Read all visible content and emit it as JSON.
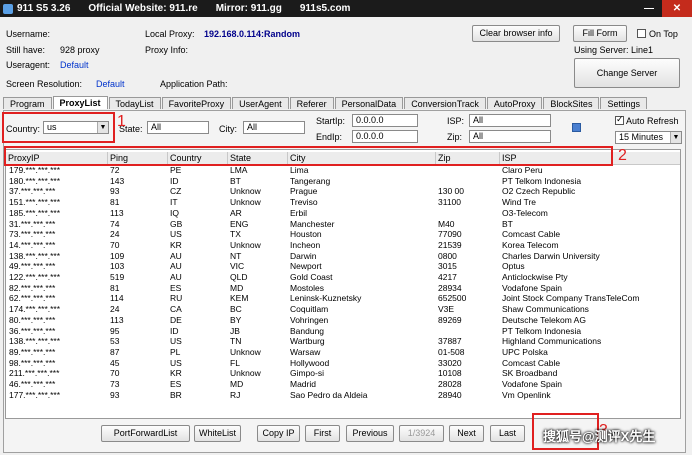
{
  "titlebar": {
    "app": "911 S5 3.26",
    "website": "Official Website: 911.re",
    "mirror": "Mirror: 911.gg",
    "mirror2": "911s5.com"
  },
  "info": {
    "username_label": "Username:",
    "still_have_label": "Still have:",
    "still_have_value": "928  proxy",
    "useragent_label": "Useragent:",
    "useragent_value": "Default",
    "screen_res_label": "Screen Resolution:",
    "screen_res_value": "Default",
    "local_proxy_label": "Local Proxy:",
    "local_proxy_value": "192.168.0.114:Random",
    "proxy_info_label": "Proxy Info:",
    "app_path_label": "Application Path:",
    "clear_browser_label": "Clear browser info",
    "fill_form_label": "Fill Form",
    "on_top_label": "On Top",
    "using_server": "Using Server: Line1",
    "change_server_label": "Change Server"
  },
  "tabs": [
    "Program",
    "ProxyList",
    "TodayList",
    "FavoriteProxy",
    "UserAgent",
    "Referer",
    "PersonalData",
    "ConversionTrack",
    "AutoProxy",
    "BlockSites",
    "Settings"
  ],
  "filters": {
    "country_label": "Country:",
    "country_value": "us",
    "state_label": "State:",
    "state_value": "All",
    "city_label": "City:",
    "city_value": "All",
    "startip_label": "StartIp:",
    "startip_value": "0.0.0.0",
    "endip_label": "EndIp:",
    "endip_value": "0.0.0.0",
    "isp_label": "ISP:",
    "isp_value": "All",
    "zip_label": "Zip:",
    "zip_value": "All",
    "auto_refresh_label": "Auto Refresh",
    "interval_value": "15 Minutes"
  },
  "annotations": {
    "n1": "1",
    "n2": "2",
    "n3": "3"
  },
  "table": {
    "headers": [
      "ProxyIP",
      "Ping",
      "Country",
      "State",
      "City",
      "Zip",
      "ISP"
    ],
    "rows": [
      [
        "179.***.***.***",
        "72",
        "PE",
        "LMA",
        "Lima",
        "",
        "Claro Peru"
      ],
      [
        "180.***.***.***",
        "143",
        "ID",
        "BT",
        "Tangerang",
        "",
        "PT Telkom Indonesia"
      ],
      [
        "37.***.***.***",
        "93",
        "CZ",
        "Unknow",
        "Prague",
        "130 00",
        "O2 Czech Republic"
      ],
      [
        "151.***.***.***",
        "81",
        "IT",
        "Unknow",
        "Treviso",
        "31100",
        "Wind Tre"
      ],
      [
        "185.***.***.***",
        "113",
        "IQ",
        "AR",
        "Erbil",
        "",
        "O3-Telecom"
      ],
      [
        "31.***.***.***",
        "74",
        "GB",
        "ENG",
        "Manchester",
        "M40",
        "BT"
      ],
      [
        "73.***.***.***",
        "24",
        "US",
        "TX",
        "Houston",
        "77090",
        "Comcast Cable"
      ],
      [
        "14.***.***.***",
        "70",
        "KR",
        "Unknow",
        "Incheon",
        "21539",
        "Korea Telecom"
      ],
      [
        "138.***.***.***",
        "109",
        "AU",
        "NT",
        "Darwin",
        "0800",
        "Charles Darwin University"
      ],
      [
        "49.***.***.***",
        "103",
        "AU",
        "VIC",
        "Newport",
        "3015",
        "Optus"
      ],
      [
        "122.***.***.***",
        "519",
        "AU",
        "QLD",
        "Gold Coast",
        "4217",
        "Anticlockwise Pty"
      ],
      [
        "82.***.***.***",
        "81",
        "ES",
        "MD",
        "Mostoles",
        "28934",
        "Vodafone Spain"
      ],
      [
        "62.***.***.***",
        "114",
        "RU",
        "KEM",
        "Leninsk-Kuznetsky",
        "652500",
        "Joint Stock Company TransTeleCom"
      ],
      [
        "174.***.***.***",
        "24",
        "CA",
        "BC",
        "Coquitlam",
        "V3E",
        "Shaw Communications"
      ],
      [
        "80.***.***.***",
        "113",
        "DE",
        "BY",
        "Vohringen",
        "89269",
        "Deutsche Telekom AG"
      ],
      [
        "36.***.***.***",
        "95",
        "ID",
        "JB",
        "Bandung",
        "",
        "PT Telkom Indonesia"
      ],
      [
        "138.***.***.***",
        "53",
        "US",
        "TN",
        "Wartburg",
        "37887",
        "Highland Communications"
      ],
      [
        "89.***.***.***",
        "87",
        "PL",
        "Unknow",
        "Warsaw",
        "01-508",
        "UPC Polska"
      ],
      [
        "98.***.***.***",
        "45",
        "US",
        "FL",
        "Hollywood",
        "33020",
        "Comcast Cable"
      ],
      [
        "211.***.***.***",
        "70",
        "KR",
        "Unknow",
        "Gimpo-si",
        "10108",
        "SK Broadband"
      ],
      [
        "46.***.***.***",
        "73",
        "ES",
        "MD",
        "Madrid",
        "28028",
        "Vodafone Spain"
      ],
      [
        "177.***.***.***",
        "93",
        "BR",
        "RJ",
        "Sao Pedro da Aldeia",
        "28940",
        "Vm Openlink"
      ]
    ]
  },
  "bottom": {
    "port_forward": "PortForwardList",
    "white_list": "WhiteList",
    "copy_ip": "Copy IP",
    "first": "First",
    "previous": "Previous",
    "page": "1/3924",
    "next": "Next",
    "last": "Last"
  },
  "watermark": "搜狐号@测评X先生"
}
